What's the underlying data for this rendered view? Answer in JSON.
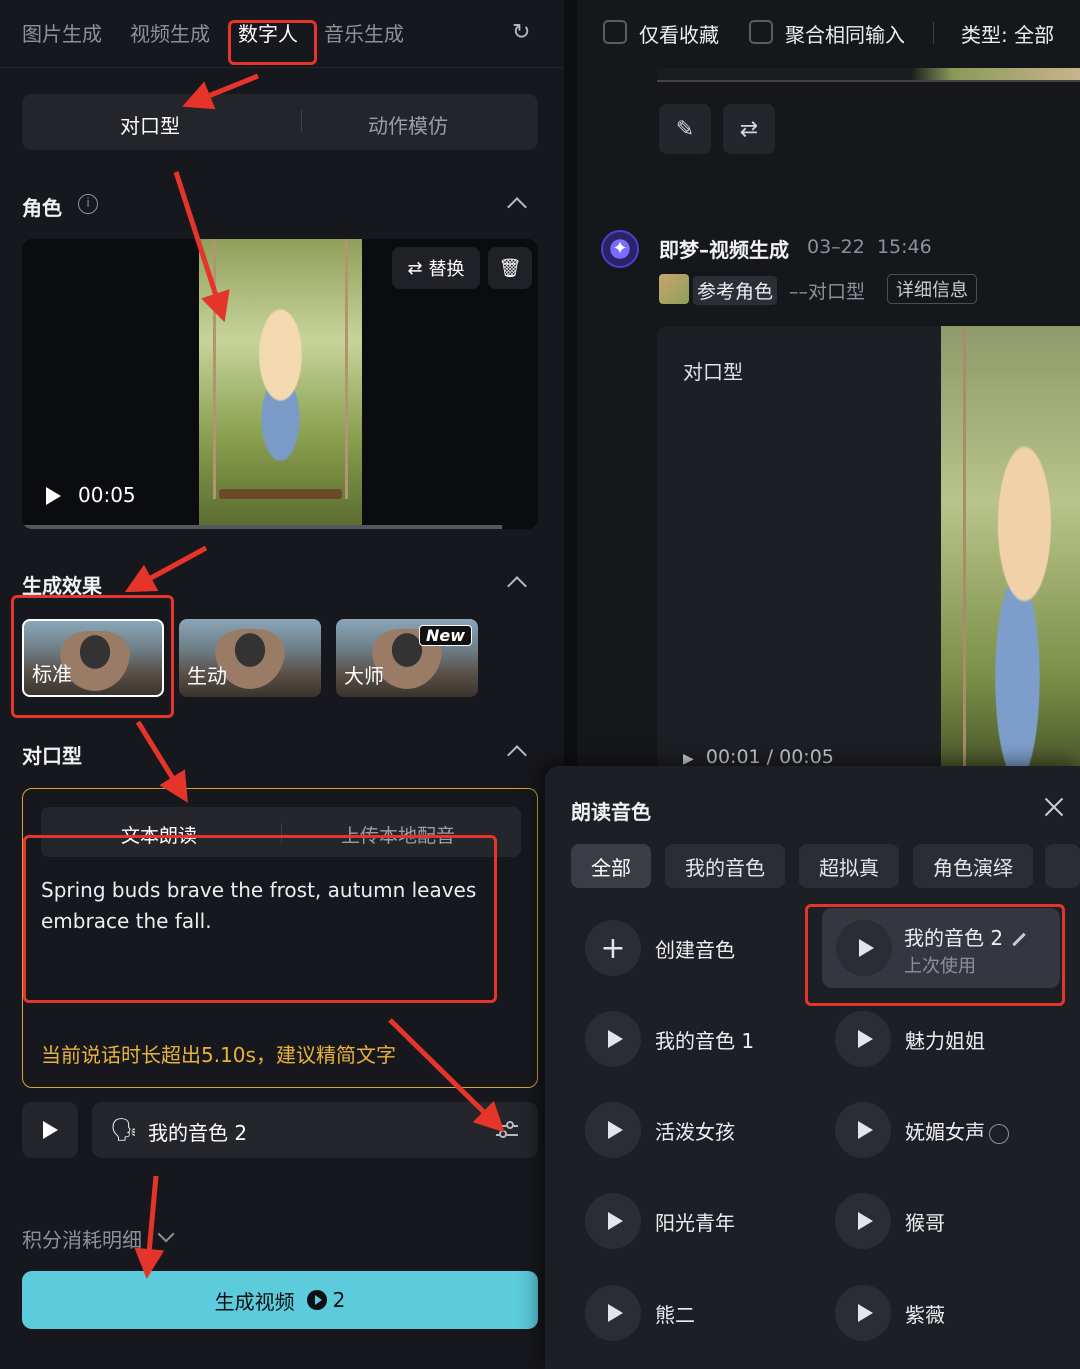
{
  "left": {
    "tabs": [
      "图片生成",
      "视频生成",
      "数字人",
      "音乐生成"
    ],
    "active_tab": "数字人",
    "mode_options": [
      "对口型",
      "动作模仿"
    ],
    "role_section": {
      "title": "角色",
      "replace_label": "替换",
      "duration": "00:05"
    },
    "effects_section": {
      "title": "生成效果",
      "items": [
        "标准",
        "生动",
        "大师"
      ],
      "new_badge": "New"
    },
    "lip_section": {
      "title": "对口型",
      "input_tabs": [
        "文本朗读",
        "上传本地配音"
      ],
      "text": "Spring buds brave the frost, autumn leaves embrace the fall.",
      "warning": "当前说话时长超出5.10s，建议精简文字"
    },
    "voice_selected": "我的音色 2",
    "credits_label": "积分消耗明细",
    "generate": {
      "label": "生成视频",
      "cost": "2"
    }
  },
  "right": {
    "filters": {
      "fav_label": "仅看收藏",
      "merge_label": "聚合相同输入",
      "type_label": "类型: 全部"
    },
    "record": {
      "app": "即梦–视频生成",
      "date": "03–22",
      "time": "15:46",
      "ref_role": "参考角色",
      "ref_type": "––对口型",
      "detail": "详细信息",
      "video_type": "对口型",
      "progress_time": "00:01",
      "total_time": "00:05"
    }
  },
  "voice_modal": {
    "title": "朗读音色",
    "tabs": [
      "全部",
      "我的音色",
      "超拟真",
      "角色演绎"
    ],
    "create_label": "创建音色",
    "selected_voice": {
      "name": "我的音色 2",
      "sub": "上次使用"
    },
    "voices": [
      "我的音色 1",
      "魅力姐姐",
      "活泼女孩",
      "妩媚女声",
      "阳光青年",
      "猴哥",
      "熊二",
      "紫薇"
    ]
  },
  "colors": {
    "accent": "#5ccbdc",
    "warning": "#e9b23a",
    "annotation": "#e5352b"
  }
}
